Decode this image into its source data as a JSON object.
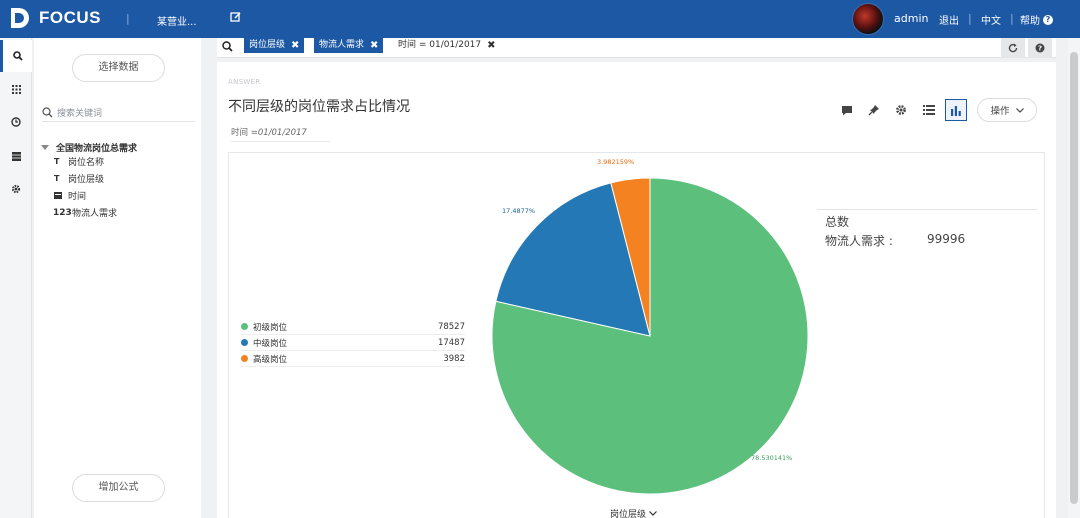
{
  "header": {
    "logo_text": "FOCUS",
    "sep1": "|",
    "workspace": "某营业...",
    "user": "admin",
    "logout": "退出",
    "sep2": "|",
    "lang": "中文",
    "sep3": "|",
    "help": "帮助",
    "help_mark": "?"
  },
  "left_panel": {
    "select_data": "选择数据",
    "search_placeholder": "搜索关键词",
    "table_name": "全国物流岗位总需求",
    "fields": [
      {
        "type_icon": "T",
        "label": "岗位名称"
      },
      {
        "type_icon": "T",
        "label": "岗位层级"
      },
      {
        "type_icon": "calendar-icon",
        "label": "时间"
      },
      {
        "type_icon": "123",
        "label": "物流人需求"
      }
    ],
    "add_formula": "增加公式"
  },
  "query": {
    "tokens": [
      "岗位层级",
      "物流人需求"
    ],
    "filter": "时间 = 01/01/2017"
  },
  "answer": {
    "label": "ANSWER",
    "title": "不同层级的岗位需求占比情况",
    "filter_key": "时间",
    "filter_value": "=01/01/2017",
    "operate_label": "操作"
  },
  "summary": {
    "title": "总数",
    "label": "物流人需求 :",
    "value": "99996"
  },
  "chart_data": {
    "type": "pie",
    "series_name": "物流人需求",
    "categories": [
      "初级岗位",
      "中级岗位",
      "高级岗位"
    ],
    "values": [
      78527,
      17487,
      3982
    ],
    "percent_labels": [
      "78.530141%",
      "17.4877%",
      "3.982159%"
    ],
    "colors": [
      "#5cbf7c",
      "#2378b5",
      "#f58220"
    ],
    "xlabel": "岗位层级",
    "legend_position": "left"
  },
  "colors": {
    "header": "#1d58a5",
    "accent": "#1d58a5"
  }
}
